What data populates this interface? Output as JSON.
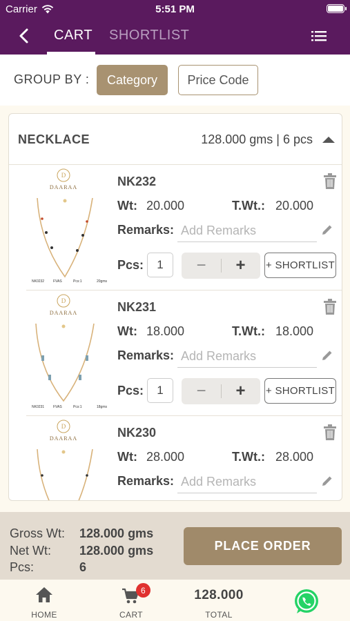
{
  "status_bar": {
    "carrier": "Carrier",
    "time": "5:51 PM"
  },
  "nav": {
    "tabs": [
      "CART",
      "SHORTLIST"
    ],
    "active_tab": "CART"
  },
  "group_by": {
    "label": "GROUP BY :",
    "options": [
      "Category",
      "Price Code"
    ],
    "selected": "Category"
  },
  "category": {
    "name": "NECKLACE",
    "summary": "128.000 gms | 6 pcs",
    "items": [
      {
        "code": "NK232",
        "wt_label": "Wt:",
        "wt": "20.000",
        "twt_label": "T.Wt.:",
        "twt": "20.000",
        "remarks_label": "Remarks:",
        "remarks_placeholder": "Add Remarks",
        "pcs_label": "Pcs:",
        "pcs": "1",
        "minus": "−",
        "plus": "+",
        "shortlist_label": "+ SHORTLIST",
        "thumb_brand": "DAARAA",
        "thumb_tag": [
          "NK0232",
          "FVAS",
          "Pcs:1",
          "20gms"
        ]
      },
      {
        "code": "NK231",
        "wt_label": "Wt:",
        "wt": "18.000",
        "twt_label": "T.Wt.:",
        "twt": "18.000",
        "remarks_label": "Remarks:",
        "remarks_placeholder": "Add Remarks",
        "pcs_label": "Pcs:",
        "pcs": "1",
        "minus": "−",
        "plus": "+",
        "shortlist_label": "+ SHORTLIST",
        "thumb_brand": "DAARAA",
        "thumb_tag": [
          "NK0231",
          "FVAS",
          "Pcs:1",
          "18gms"
        ]
      },
      {
        "code": "NK230",
        "wt_label": "Wt:",
        "wt": "28.000",
        "twt_label": "T.Wt.:",
        "twt": "28.000",
        "remarks_label": "Remarks:",
        "remarks_placeholder": "Add Remarks",
        "thumb_brand": "DAARAA"
      }
    ]
  },
  "totals": {
    "gross_label": "Gross Wt:",
    "gross": "128.000 gms",
    "net_label": "Net Wt:",
    "net": "128.000 gms",
    "pcs_label": "Pcs:",
    "pcs": "6",
    "place_order": "PLACE ORDER"
  },
  "tabbar": {
    "home": "HOME",
    "cart": "CART",
    "cart_badge": "6",
    "total_value": "128.000",
    "total": "TOTAL"
  },
  "colors": {
    "header": "#5a1a5e",
    "accent": "#a89271",
    "badge": "#e0312f",
    "whatsapp": "#25d366"
  },
  "icons": [
    "wifi-icon",
    "battery-icon",
    "back-arrow-icon",
    "menu-icon",
    "caret-up-icon",
    "trash-icon",
    "pencil-icon",
    "home-icon",
    "cart-icon",
    "whatsapp-icon"
  ]
}
